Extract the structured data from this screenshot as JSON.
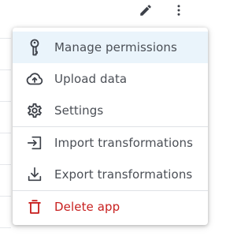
{
  "toolbar": {
    "edit_icon": "pencil-icon",
    "more_icon": "vertical-dots-icon"
  },
  "menu": {
    "items": [
      {
        "label": "Manage permissions",
        "icon": "key-icon",
        "active": true
      },
      {
        "label": "Upload data",
        "icon": "cloud-upload-icon"
      },
      {
        "label": "Settings",
        "icon": "gear-icon"
      },
      {
        "label": "Import transformations",
        "icon": "import-icon"
      },
      {
        "label": "Export transformations",
        "icon": "download-icon"
      },
      {
        "label": "Delete app",
        "icon": "trash-icon",
        "danger": true
      }
    ]
  },
  "colors": {
    "text": "#4b4f56",
    "active_bg": "#eaf4fb",
    "danger": "#c8201f",
    "icon": "#3d4149"
  }
}
